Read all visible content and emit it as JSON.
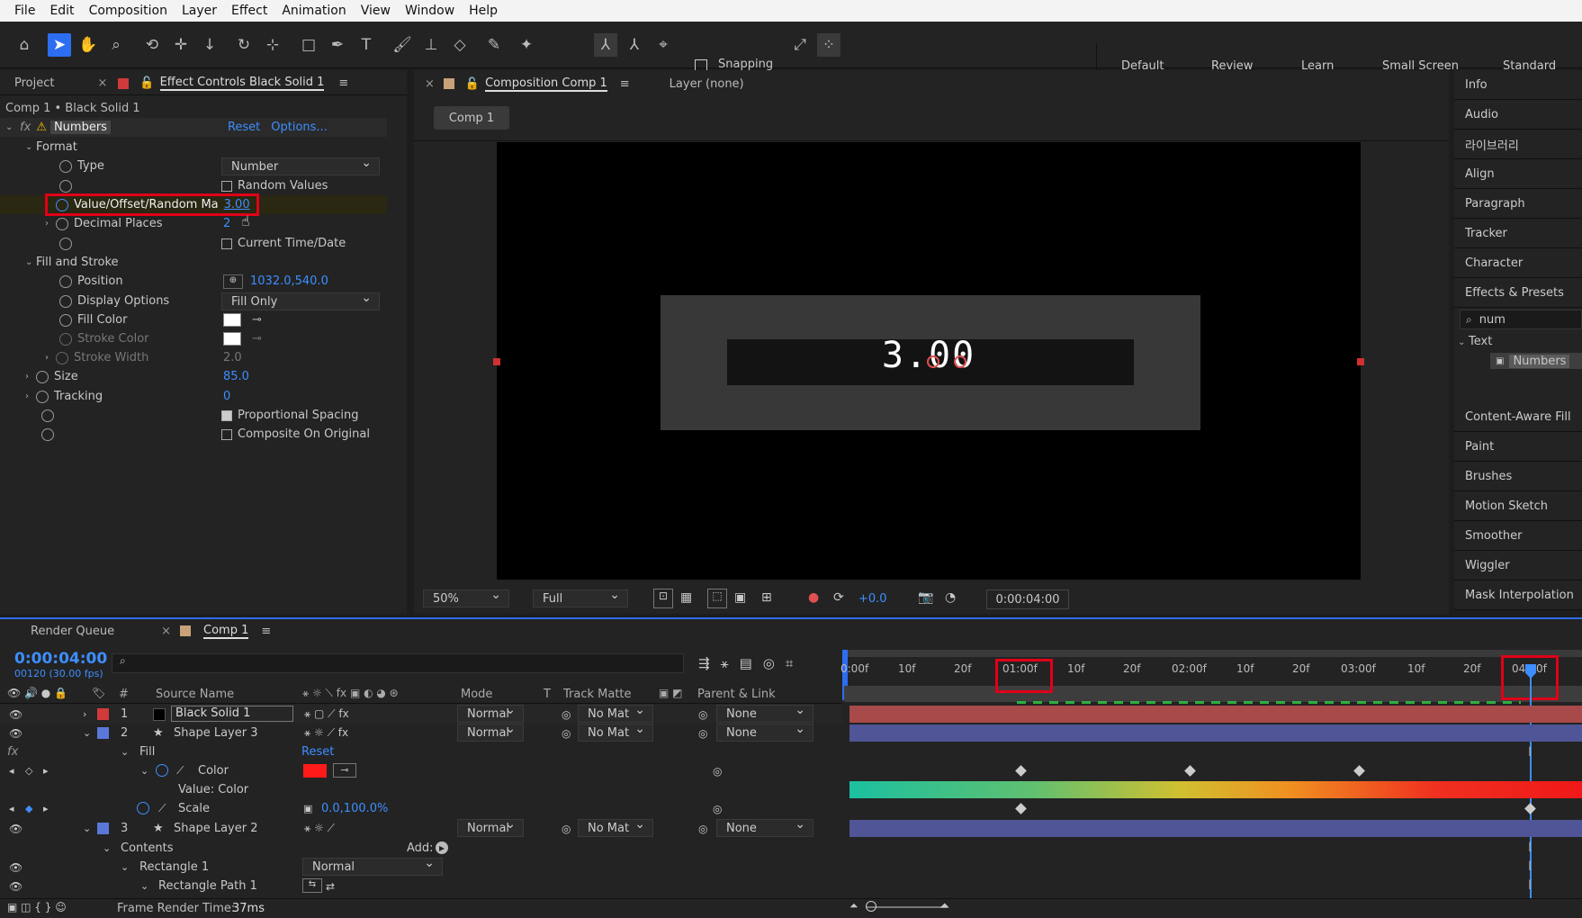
{
  "menu": [
    "File",
    "Edit",
    "Composition",
    "Layer",
    "Effect",
    "Animation",
    "View",
    "Window",
    "Help"
  ],
  "toolbar": {
    "snapping": "Snapping"
  },
  "workspaces": [
    "Default",
    "Review",
    "Learn",
    "Small Screen",
    "Standard"
  ],
  "left_panel": {
    "tab_project": "Project",
    "tab_effect": "Effect Controls Black Solid 1",
    "context": "Comp 1 • Black Solid 1",
    "effect_name": "Numbers",
    "reset": "Reset",
    "options": "Options...",
    "format": "Format",
    "type_label": "Type",
    "type_value": "Number",
    "random_values": "Random Values",
    "value_label": "Value/Offset/Random Ma",
    "value_value": "3.00",
    "decimal_label": "Decimal Places",
    "decimal_value": "2",
    "current_time": "Current Time/Date",
    "fill_stroke": "Fill and Stroke",
    "position_label": "Position",
    "position_value": "1032.0,540.0",
    "display_label": "Display Options",
    "display_value": "Fill Only",
    "fill_color": "Fill Color",
    "stroke_color": "Stroke Color",
    "stroke_width": "Stroke Width",
    "stroke_width_value": "2.0",
    "size": "Size",
    "size_value": "85.0",
    "tracking": "Tracking",
    "tracking_value": "0",
    "proportional": "Proportional Spacing",
    "composite": "Composite On Original"
  },
  "comp_panel": {
    "tab": "Composition Comp 1",
    "layer_tab": "Layer (none)",
    "comp_btn": "Comp 1",
    "display_number": "3.00",
    "zoom": "50%",
    "resolution": "Full",
    "exposure": "+0.0",
    "timecode": "0:00:04:00"
  },
  "right_panel": [
    "Info",
    "Audio",
    "라이브러리",
    "Align",
    "Paragraph",
    "Tracker",
    "Character",
    "Effects & Presets"
  ],
  "effects_search": "num",
  "effects_group": "Text",
  "effects_item": "Numbers",
  "right_panel2": [
    "Content-Aware Fill",
    "Paint",
    "Brushes",
    "Motion Sketch",
    "Smoother",
    "Wiggler",
    "Mask Interpolation"
  ],
  "timeline": {
    "tab_rq": "Render Queue",
    "tab_comp": "Comp 1",
    "timecode": "0:00:04:00",
    "frames": "00120 (30.00 fps)",
    "cols": {
      "num": "#",
      "source": "Source Name",
      "mode": "Mode",
      "t": "T",
      "matte": "Track Matte",
      "parent": "Parent & Link"
    },
    "ruler": [
      "0:00f",
      "10f",
      "20f",
      "01:00f",
      "10f",
      "20f",
      "02:00f",
      "10f",
      "20f",
      "03:00f",
      "10f",
      "20f",
      "04:00f"
    ],
    "layers": [
      {
        "n": "1",
        "name": "Black Solid 1",
        "mode": "Normal",
        "matte": "No Mat",
        "parent": "None"
      },
      {
        "n": "2",
        "name": "Shape Layer 3",
        "mode": "Normal",
        "matte": "No Mat",
        "parent": "None"
      },
      {
        "n": "3",
        "name": "Shape Layer 2",
        "mode": "Normal",
        "matte": "No Mat",
        "parent": "None"
      }
    ],
    "fill": "Fill",
    "reset": "Reset",
    "color": "Color",
    "value_color": "Value: Color",
    "scale": "Scale",
    "scale_value": "0.0,100.0%",
    "contents": "Contents",
    "add": "Add:",
    "rect1": "Rectangle 1",
    "rect1_mode": "Normal",
    "rectpath": "Rectangle Path 1",
    "render_time_label": "Frame Render Time:",
    "render_time": "37ms"
  },
  "colors": {
    "accent": "#2d6df0",
    "red_outline": "#e00018",
    "layer_red": "#a84a4a",
    "layer_blue": "#4f5596"
  }
}
